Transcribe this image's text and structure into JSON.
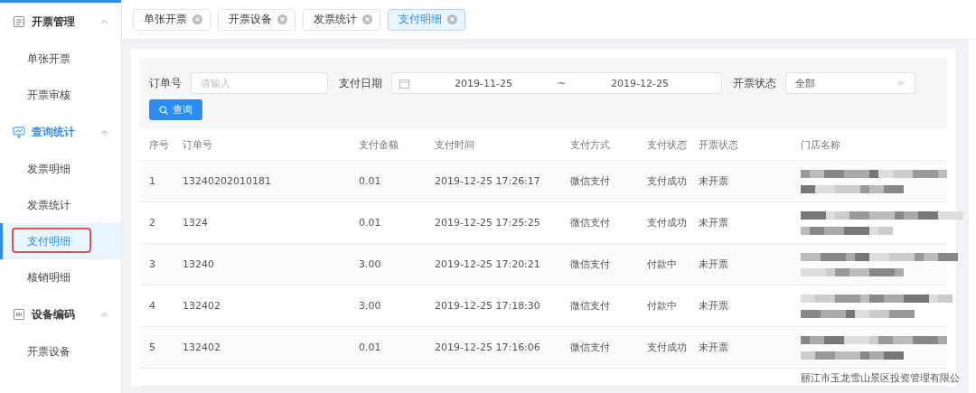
{
  "sidebar": {
    "groups": [
      {
        "title": "开票管理",
        "active": false,
        "expanded": true,
        "items": [
          {
            "label": "单张开票",
            "selected": false,
            "highlighted": false
          },
          {
            "label": "开票审核",
            "selected": false,
            "highlighted": false
          }
        ]
      },
      {
        "title": "查询统计",
        "active": true,
        "expanded": true,
        "items": [
          {
            "label": "发票明细",
            "selected": false,
            "highlighted": false
          },
          {
            "label": "发票统计",
            "selected": false,
            "highlighted": false
          },
          {
            "label": "支付明细",
            "selected": true,
            "highlighted": true
          },
          {
            "label": "核销明细",
            "selected": false,
            "highlighted": false
          }
        ]
      },
      {
        "title": "设备编码",
        "active": false,
        "expanded": true,
        "items": [
          {
            "label": "开票设备",
            "selected": false,
            "highlighted": false
          }
        ]
      }
    ]
  },
  "tabs": [
    {
      "label": "单张开票",
      "selected": false
    },
    {
      "label": "开票设备",
      "selected": false
    },
    {
      "label": "发票统计",
      "selected": false
    },
    {
      "label": "支付明细",
      "selected": true
    }
  ],
  "filters": {
    "order_no": {
      "label": "订单号",
      "placeholder": "请输入"
    },
    "pay_date": {
      "label": "支付日期",
      "start": "2019-11-25",
      "separator": "~",
      "end": "2019-12-25"
    },
    "invoice_status": {
      "label": "开票状态",
      "value": "全部"
    },
    "search_button": "查询"
  },
  "table": {
    "columns": [
      "序号",
      "订单号",
      "支付金额",
      "支付时间",
      "支付方式",
      "支付状态",
      "开票状态",
      "门店名称"
    ],
    "rows": [
      {
        "index": "1",
        "order_no": "13240202010181",
        "amount": "0.01",
        "time": "2019-12-25 17:26:17",
        "method": "微信支付",
        "pay_status": "支付成功",
        "invoice_status": "未开票",
        "store_redacted": true
      },
      {
        "index": "2",
        "order_no": "1324",
        "amount": "0.01",
        "time": "2019-12-25 17:25:25",
        "method": "微信支付",
        "pay_status": "支付成功",
        "invoice_status": "未开票",
        "store_redacted": true
      },
      {
        "index": "3",
        "order_no": "13240",
        "amount": "3.00",
        "time": "2019-12-25 17:20:21",
        "method": "微信支付",
        "pay_status": "付款中",
        "invoice_status": "未开票",
        "store_redacted": true
      },
      {
        "index": "4",
        "order_no": "132402",
        "amount": "3.00",
        "time": "2019-12-25 17:18:30",
        "method": "微信支付",
        "pay_status": "付款中",
        "invoice_status": "未开票",
        "store_redacted": true
      },
      {
        "index": "5",
        "order_no": "132402",
        "amount": "0.01",
        "time": "2019-12-25 17:16:06",
        "method": "微信支付",
        "pay_status": "支付成功",
        "invoice_status": "未开票",
        "store_redacted": true
      },
      {
        "store": "丽江市玉龙雪山景区投资管理有限公",
        "store_redacted": false
      }
    ]
  }
}
